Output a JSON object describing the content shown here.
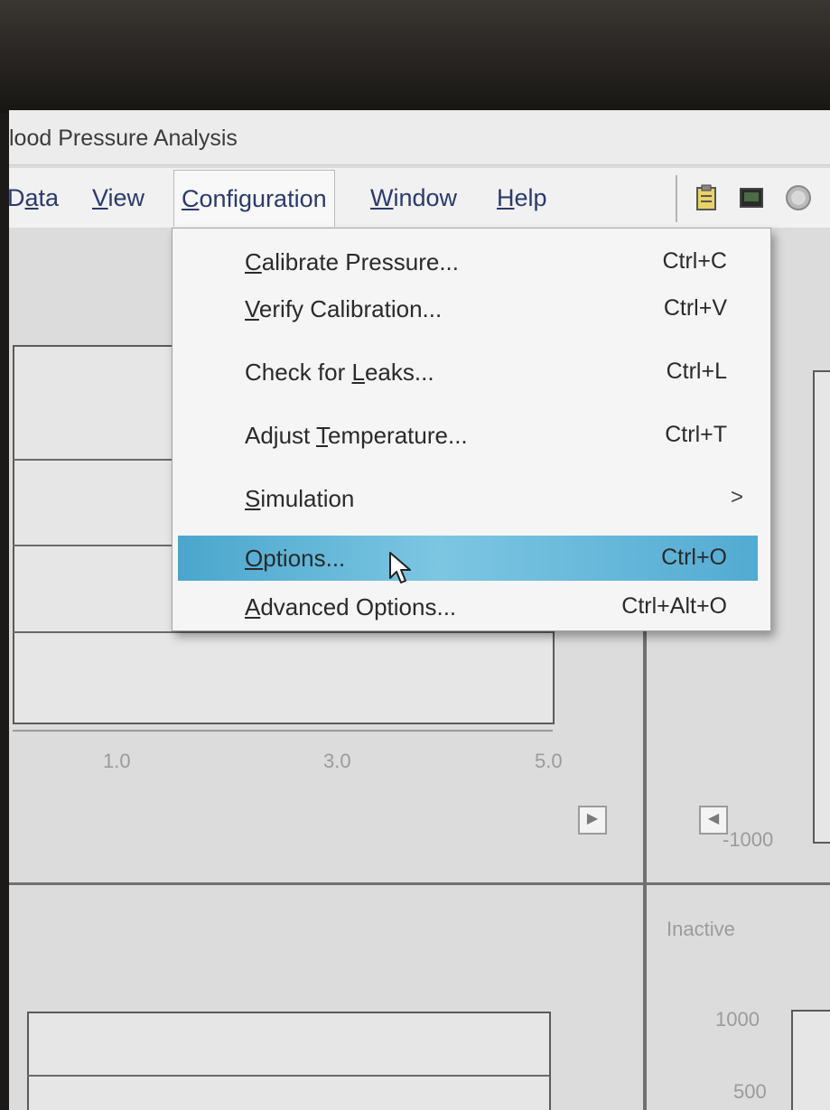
{
  "window": {
    "title": "lood Pressure Analysis"
  },
  "menubar": {
    "items": [
      {
        "label": "Data",
        "mnemonic": "a"
      },
      {
        "label": "View",
        "mnemonic": "V"
      },
      {
        "label": "Configuration",
        "mnemonic": "C"
      },
      {
        "label": "Window",
        "mnemonic": "W"
      },
      {
        "label": "Help",
        "mnemonic": "H"
      }
    ],
    "active": "Configuration"
  },
  "toolbar": {
    "icons": [
      "clipboard-icon",
      "monitor-icon",
      "stop-icon"
    ]
  },
  "configuration_menu": {
    "items": [
      {
        "label": "Calibrate Pressure...",
        "shortcut": "Ctrl+C"
      },
      {
        "label": "Verify Calibration...",
        "shortcut": "Ctrl+V"
      },
      {
        "label": "Check for Leaks...",
        "shortcut": "Ctrl+L"
      },
      {
        "label": "Adjust Temperature...",
        "shortcut": "Ctrl+T"
      },
      {
        "label": "Simulation",
        "shortcut": "",
        "submenu_arrow": ">"
      },
      {
        "label": "Options...",
        "shortcut": "Ctrl+O",
        "highlighted": true
      },
      {
        "label": "Advanced Options...",
        "shortcut": "Ctrl+Alt+O"
      }
    ]
  },
  "left_plot": {
    "x_ticks": [
      "1.0",
      "3.0",
      "5.0"
    ]
  },
  "right_plot": {
    "y_ticks": [
      "-1000"
    ]
  },
  "lower_right_panel": {
    "status": "Inactive",
    "y_ticks": [
      "1000",
      "500"
    ]
  },
  "colors": {
    "highlight": "#5ab3d8",
    "menu_text": "#2b3a6b"
  }
}
